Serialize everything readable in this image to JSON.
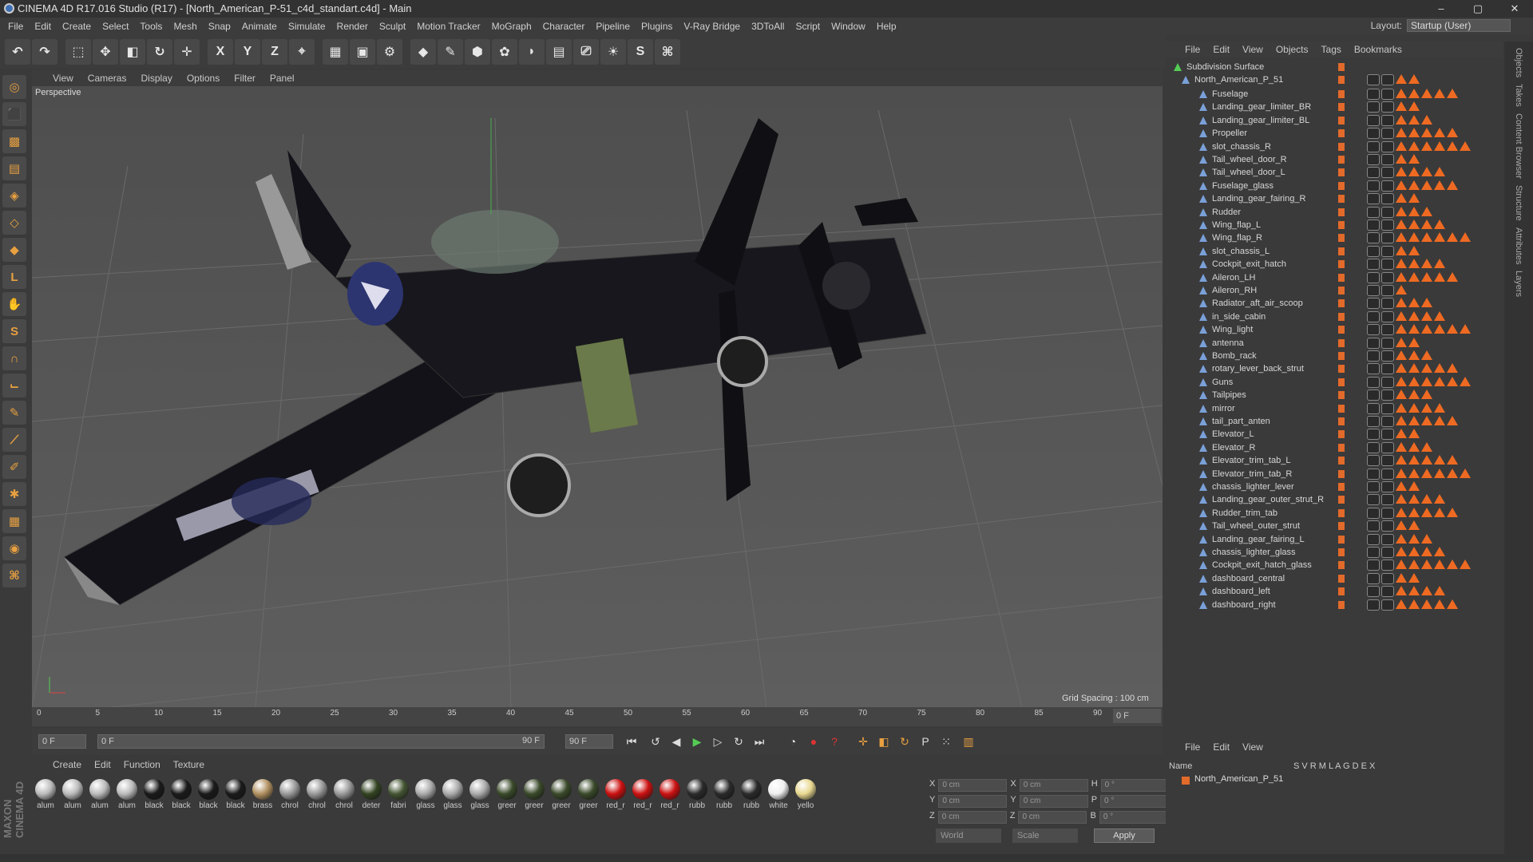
{
  "window": {
    "title": "CINEMA 4D R17.016 Studio (R17) - [North_American_P-51_c4d_standart.c4d] - Main",
    "min": "–",
    "max": "▢",
    "close": "✕"
  },
  "menu": [
    "File",
    "Edit",
    "Create",
    "Select",
    "Tools",
    "Mesh",
    "Snap",
    "Animate",
    "Simulate",
    "Render",
    "Sculpt",
    "Motion Tracker",
    "MoGraph",
    "Character",
    "Pipeline",
    "Plugins",
    "V-Ray Bridge",
    "3DToAll",
    "Script",
    "Window",
    "Help"
  ],
  "layout": {
    "label": "Layout:",
    "value": "Startup (User)"
  },
  "toolbar": {
    "x": "X",
    "y": "Y",
    "z": "Z"
  },
  "viewport": {
    "menu": [
      "View",
      "Cameras",
      "Display",
      "Options",
      "Filter",
      "Panel"
    ],
    "label": "Perspective",
    "grid_spacing": "Grid Spacing : 100 cm"
  },
  "timeline": {
    "ticks": [
      "0",
      "5",
      "10",
      "15",
      "20",
      "25",
      "30",
      "35",
      "40",
      "45",
      "50",
      "55",
      "60",
      "65",
      "70",
      "75",
      "80",
      "85",
      "90"
    ],
    "frame": "0 F"
  },
  "transport": {
    "start": "0 F",
    "cur": "0 F",
    "end": "90 F",
    "end2": "90 F"
  },
  "materials": {
    "menu": [
      "Create",
      "Edit",
      "Function",
      "Texture"
    ],
    "items": [
      "alum",
      "alum",
      "alum",
      "alum",
      "black",
      "black",
      "black",
      "black",
      "brass",
      "chrol",
      "chrol",
      "chrol",
      "deter",
      "fabri",
      "glass",
      "glass",
      "glass",
      "greer",
      "greer",
      "greer",
      "greer",
      "red_r",
      "red_r",
      "red_r",
      "rubb",
      "rubb",
      "rubb",
      "white",
      "yello"
    ]
  },
  "coords": {
    "x_pos": "0 cm",
    "y_pos": "0 cm",
    "z_pos": "0 cm",
    "x_size": "0 cm",
    "y_size": "0 cm",
    "z_size": "0 cm",
    "h": "0 °",
    "p": "0 °",
    "b": "0 °",
    "labels": {
      "x": "X",
      "y": "Y",
      "z": "Z",
      "h": "H",
      "p": "P",
      "b": "B"
    },
    "mode1": "World",
    "mode2": "Scale",
    "apply": "Apply"
  },
  "objects": {
    "menu": [
      "File",
      "Edit",
      "View",
      "Objects",
      "Tags",
      "Bookmarks"
    ],
    "root": "Subdivision Surface",
    "group": "North_American_P_51",
    "items": [
      "Fuselage",
      "Landing_gear_limiter_BR",
      "Landing_gear_limiter_BL",
      "Propeller",
      "slot_chassis_R",
      "Tail_wheel_door_R",
      "Tail_wheel_door_L",
      "Fuselage_glass",
      "Landing_gear_fairing_R",
      "Rudder",
      "Wing_flap_L",
      "Wing_flap_R",
      "slot_chassis_L",
      "Cockpit_exit_hatch",
      "Aileron_LH",
      "Aileron_RH",
      "Radiator_aft_air_scoop",
      "in_side_cabin",
      "Wing_light",
      "antenna",
      "Bomb_rack",
      "rotary_lever_back_strut",
      "Guns",
      "Tailpipes",
      "mirror",
      "tail_part_anten",
      "Elevator_L",
      "Elevator_R",
      "Elevator_trim_tab_L",
      "Elevator_trim_tab_R",
      "chassis_lighter_lever",
      "Landing_gear_outer_strut_R",
      "Rudder_trim_tab",
      "Tail_wheel_outer_strut",
      "Landing_gear_fairing_L",
      "chassis_lighter_glass",
      "Cockpit_exit_hatch_glass",
      "dashboard_central",
      "dashboard_left",
      "dashboard_right"
    ]
  },
  "layers": {
    "menu": [
      "File",
      "Edit",
      "View"
    ],
    "header": "Name",
    "cols": "S  V  R  M  L  A  G  D  E  X",
    "row": "North_American_P_51"
  },
  "right_tabs": [
    "Objects",
    "Takes",
    "Content Browser",
    "Structure",
    "Attributes",
    "Layers"
  ],
  "brand": "MAXON CINEMA 4D",
  "colors": {
    "accent": "#e26a2a",
    "bg": "#3a3a3a",
    "viewport": "#5a5a5a"
  }
}
